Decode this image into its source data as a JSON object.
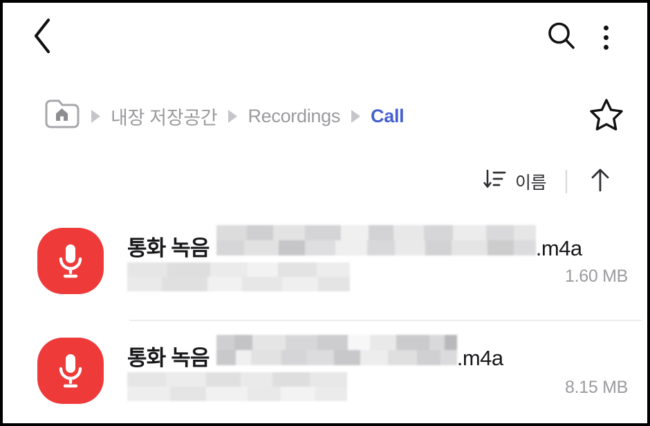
{
  "appbar": {
    "back_icon": "back-chevron-icon",
    "search_icon": "search-icon",
    "overflow_icon": "more-vertical-icon"
  },
  "breadcrumb": {
    "home_icon": "folder-home-icon",
    "separator_icon": "caret-right-icon",
    "items": [
      {
        "label": "내장 저장공간",
        "current": false
      },
      {
        "label": "Recordings",
        "current": false
      },
      {
        "label": "Call",
        "current": true
      }
    ],
    "favorite_icon": "star-outline-icon",
    "current_color": "#4560cf",
    "inactive_color": "#9a9a9e"
  },
  "sortbar": {
    "sort_icon": "sort-descending-icon",
    "sort_label": "이름",
    "order_icon": "arrow-up-icon"
  },
  "files": [
    {
      "icon": "voice-recorder-microphone-icon",
      "icon_color": "#ef3a3a",
      "name_prefix": "통화 녹음",
      "name_redacted": true,
      "extension": ".m4a",
      "subtitle_redacted": true,
      "size": "1.60 MB"
    },
    {
      "icon": "voice-recorder-microphone-icon",
      "icon_color": "#ef3a3a",
      "name_prefix": "통화 녹음",
      "name_redacted": true,
      "extension": ".m4a",
      "subtitle_redacted": true,
      "size": "8.15 MB"
    }
  ]
}
